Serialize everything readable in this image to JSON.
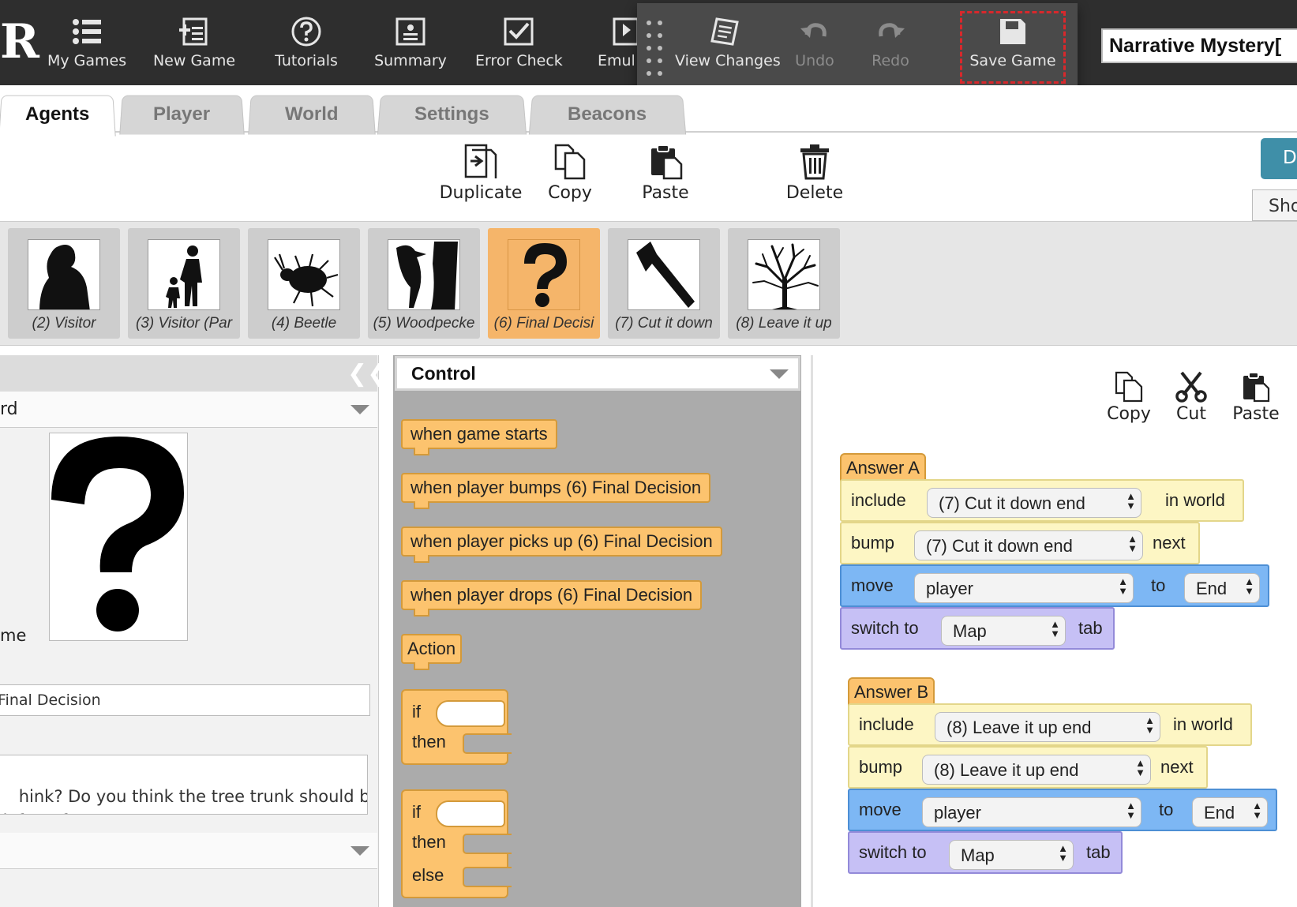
{
  "app": {
    "logo": "R",
    "game_title": "Narrative Mystery["
  },
  "topbar": {
    "buttons": [
      {
        "label": "My Games",
        "icon": "list-icon"
      },
      {
        "label": "New Game",
        "icon": "new-game-icon"
      },
      {
        "label": "Tutorials",
        "icon": "help-circle-icon"
      },
      {
        "label": "Summary",
        "icon": "summary-icon"
      },
      {
        "label": "Error Check",
        "icon": "checkbox-icon"
      },
      {
        "label": "Emul",
        "icon": "emulator-icon"
      }
    ],
    "floating": {
      "view_changes": "View Changes",
      "undo": "Undo",
      "redo": "Redo",
      "save_game": "Save Game"
    }
  },
  "tabs": [
    {
      "label": "Agents",
      "active": true
    },
    {
      "label": "Player",
      "active": false
    },
    {
      "label": "World",
      "active": false
    },
    {
      "label": "Settings",
      "active": false
    },
    {
      "label": "Beacons",
      "active": false
    }
  ],
  "actions": {
    "duplicate": "Duplicate",
    "copy": "Copy",
    "paste": "Paste",
    "delete": "Delete",
    "right_button": "De",
    "right_button2": "Sho"
  },
  "agents": [
    {
      "name": "(2) Visitor",
      "icon": "woman-silhouette-icon",
      "selected": false
    },
    {
      "name": "(3) Visitor (Par",
      "icon": "parent-child-icon",
      "selected": false
    },
    {
      "name": "(4) Beetle",
      "icon": "beetle-icon",
      "selected": false
    },
    {
      "name": "(5) Woodpecke",
      "icon": "woodpecker-icon",
      "selected": false
    },
    {
      "name": "(6) Final Decisi",
      "icon": "question-mark-icon",
      "selected": true
    },
    {
      "name": "(7) Cut it down",
      "icon": "axe-icon",
      "selected": false
    },
    {
      "name": "(8) Leave it up",
      "icon": "tree-icon",
      "selected": false
    }
  ],
  "left_panel": {
    "row1_label": "rd",
    "name_label": "me",
    "name_value": "Final Decision",
    "text_value": "hink? Do you think the tree trunk should be\n left up for now?"
  },
  "palette": {
    "category": "Control",
    "blocks": [
      "when game starts",
      "when player bumps (6) Final Decision",
      "when player picks up (6) Final Decision",
      "when player drops (6) Final Decision",
      "Action"
    ],
    "if_label": "if",
    "then_label": "then",
    "else_label": "else"
  },
  "workspace": {
    "copy": "Copy",
    "cut": "Cut",
    "paste": "Paste",
    "groups": [
      {
        "hat": "Answer A",
        "include": {
          "label": "include",
          "value": "(7) Cut it down end",
          "suffix": "in world"
        },
        "bump": {
          "label": "bump",
          "value": "(7) Cut it down end",
          "suffix": "next"
        },
        "move": {
          "label": "move",
          "value": "player",
          "to": "to",
          "target": "End"
        },
        "switch": {
          "label": "switch to",
          "value": "Map",
          "suffix": "tab"
        }
      },
      {
        "hat": "Answer B",
        "include": {
          "label": "include",
          "value": "(8) Leave it up end",
          "suffix": "in world"
        },
        "bump": {
          "label": "bump",
          "value": "(8) Leave it up end",
          "suffix": "next"
        },
        "move": {
          "label": "move",
          "value": "player",
          "to": "to",
          "target": "End"
        },
        "switch": {
          "label": "switch to",
          "value": "Map",
          "suffix": "tab"
        }
      }
    ]
  },
  "colors": {
    "topbar": "#2e2e2e",
    "selected_agent": "#f5b56a",
    "event_block": "#fcc36e",
    "include_block": "#fdf6c4",
    "move_block": "#7db7f4",
    "switch_block": "#c6c0f5",
    "save_highlight": "#d8282c"
  }
}
